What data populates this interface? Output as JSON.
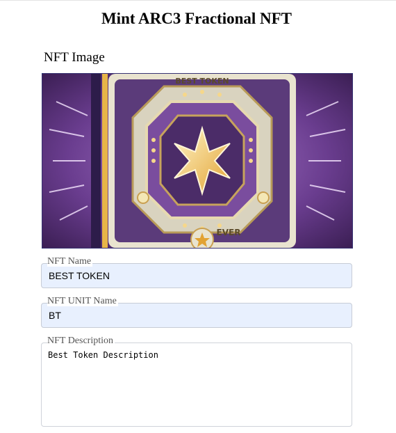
{
  "page": {
    "title": "Mint ARC3 Fractional NFT"
  },
  "image_section": {
    "label": "NFT Image",
    "art_text_top": "BEST TOKEN",
    "art_text_bottom": "EVER"
  },
  "form": {
    "name": {
      "label": "NFT Name",
      "value": "BEST TOKEN"
    },
    "unit_name": {
      "label": "NFT UNIT Name",
      "value": "BT"
    },
    "description": {
      "label": "NFT Description",
      "value": "Best Token Description"
    }
  },
  "colors": {
    "field_fill": "#e8f0fe",
    "image_border": "#243a7a",
    "art_purple": "#6a3d8f",
    "art_gold": "#f0b83a"
  }
}
